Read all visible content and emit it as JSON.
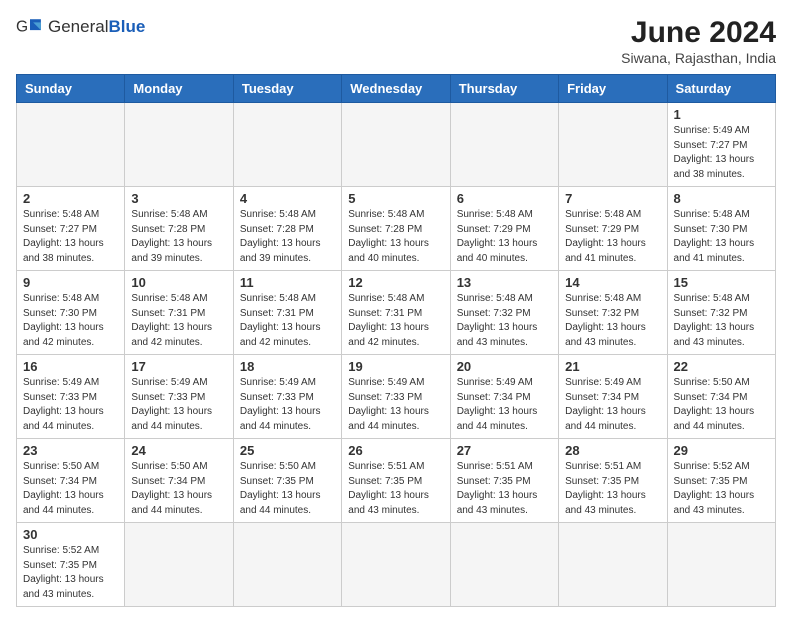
{
  "header": {
    "logo_general": "General",
    "logo_blue": "Blue",
    "month_year": "June 2024",
    "location": "Siwana, Rajasthan, India"
  },
  "weekdays": [
    "Sunday",
    "Monday",
    "Tuesday",
    "Wednesday",
    "Thursday",
    "Friday",
    "Saturday"
  ],
  "weeks": [
    [
      {
        "day": "",
        "info": ""
      },
      {
        "day": "",
        "info": ""
      },
      {
        "day": "",
        "info": ""
      },
      {
        "day": "",
        "info": ""
      },
      {
        "day": "",
        "info": ""
      },
      {
        "day": "",
        "info": ""
      },
      {
        "day": "1",
        "info": "Sunrise: 5:49 AM\nSunset: 7:27 PM\nDaylight: 13 hours and 38 minutes."
      }
    ],
    [
      {
        "day": "2",
        "info": "Sunrise: 5:48 AM\nSunset: 7:27 PM\nDaylight: 13 hours and 38 minutes."
      },
      {
        "day": "3",
        "info": "Sunrise: 5:48 AM\nSunset: 7:28 PM\nDaylight: 13 hours and 39 minutes."
      },
      {
        "day": "4",
        "info": "Sunrise: 5:48 AM\nSunset: 7:28 PM\nDaylight: 13 hours and 39 minutes."
      },
      {
        "day": "5",
        "info": "Sunrise: 5:48 AM\nSunset: 7:28 PM\nDaylight: 13 hours and 40 minutes."
      },
      {
        "day": "6",
        "info": "Sunrise: 5:48 AM\nSunset: 7:29 PM\nDaylight: 13 hours and 40 minutes."
      },
      {
        "day": "7",
        "info": "Sunrise: 5:48 AM\nSunset: 7:29 PM\nDaylight: 13 hours and 41 minutes."
      },
      {
        "day": "8",
        "info": "Sunrise: 5:48 AM\nSunset: 7:30 PM\nDaylight: 13 hours and 41 minutes."
      }
    ],
    [
      {
        "day": "9",
        "info": "Sunrise: 5:48 AM\nSunset: 7:30 PM\nDaylight: 13 hours and 42 minutes."
      },
      {
        "day": "10",
        "info": "Sunrise: 5:48 AM\nSunset: 7:31 PM\nDaylight: 13 hours and 42 minutes."
      },
      {
        "day": "11",
        "info": "Sunrise: 5:48 AM\nSunset: 7:31 PM\nDaylight: 13 hours and 42 minutes."
      },
      {
        "day": "12",
        "info": "Sunrise: 5:48 AM\nSunset: 7:31 PM\nDaylight: 13 hours and 42 minutes."
      },
      {
        "day": "13",
        "info": "Sunrise: 5:48 AM\nSunset: 7:32 PM\nDaylight: 13 hours and 43 minutes."
      },
      {
        "day": "14",
        "info": "Sunrise: 5:48 AM\nSunset: 7:32 PM\nDaylight: 13 hours and 43 minutes."
      },
      {
        "day": "15",
        "info": "Sunrise: 5:48 AM\nSunset: 7:32 PM\nDaylight: 13 hours and 43 minutes."
      }
    ],
    [
      {
        "day": "16",
        "info": "Sunrise: 5:49 AM\nSunset: 7:33 PM\nDaylight: 13 hours and 44 minutes."
      },
      {
        "day": "17",
        "info": "Sunrise: 5:49 AM\nSunset: 7:33 PM\nDaylight: 13 hours and 44 minutes."
      },
      {
        "day": "18",
        "info": "Sunrise: 5:49 AM\nSunset: 7:33 PM\nDaylight: 13 hours and 44 minutes."
      },
      {
        "day": "19",
        "info": "Sunrise: 5:49 AM\nSunset: 7:33 PM\nDaylight: 13 hours and 44 minutes."
      },
      {
        "day": "20",
        "info": "Sunrise: 5:49 AM\nSunset: 7:34 PM\nDaylight: 13 hours and 44 minutes."
      },
      {
        "day": "21",
        "info": "Sunrise: 5:49 AM\nSunset: 7:34 PM\nDaylight: 13 hours and 44 minutes."
      },
      {
        "day": "22",
        "info": "Sunrise: 5:50 AM\nSunset: 7:34 PM\nDaylight: 13 hours and 44 minutes."
      }
    ],
    [
      {
        "day": "23",
        "info": "Sunrise: 5:50 AM\nSunset: 7:34 PM\nDaylight: 13 hours and 44 minutes."
      },
      {
        "day": "24",
        "info": "Sunrise: 5:50 AM\nSunset: 7:34 PM\nDaylight: 13 hours and 44 minutes."
      },
      {
        "day": "25",
        "info": "Sunrise: 5:50 AM\nSunset: 7:35 PM\nDaylight: 13 hours and 44 minutes."
      },
      {
        "day": "26",
        "info": "Sunrise: 5:51 AM\nSunset: 7:35 PM\nDaylight: 13 hours and 43 minutes."
      },
      {
        "day": "27",
        "info": "Sunrise: 5:51 AM\nSunset: 7:35 PM\nDaylight: 13 hours and 43 minutes."
      },
      {
        "day": "28",
        "info": "Sunrise: 5:51 AM\nSunset: 7:35 PM\nDaylight: 13 hours and 43 minutes."
      },
      {
        "day": "29",
        "info": "Sunrise: 5:52 AM\nSunset: 7:35 PM\nDaylight: 13 hours and 43 minutes."
      }
    ],
    [
      {
        "day": "30",
        "info": "Sunrise: 5:52 AM\nSunset: 7:35 PM\nDaylight: 13 hours and 43 minutes."
      },
      {
        "day": "",
        "info": ""
      },
      {
        "day": "",
        "info": ""
      },
      {
        "day": "",
        "info": ""
      },
      {
        "day": "",
        "info": ""
      },
      {
        "day": "",
        "info": ""
      },
      {
        "day": "",
        "info": ""
      }
    ]
  ]
}
